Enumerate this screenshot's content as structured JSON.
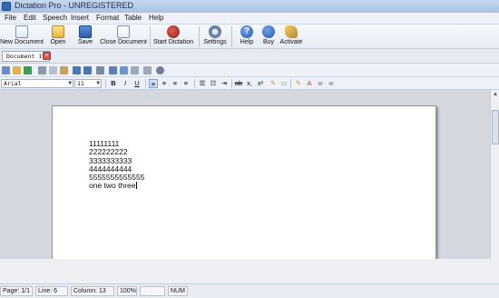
{
  "window": {
    "title": "Dictation Pro - UNREGISTERED"
  },
  "menu": [
    "File",
    "Edit",
    "Speech",
    "Insert",
    "Format",
    "Table",
    "Help"
  ],
  "toolbar": {
    "new_document": "New Document",
    "open": "Open",
    "save": "Save",
    "close_document": "Close Document",
    "start_dictation": "Start Dictation",
    "settings": "Settings",
    "help": "Help",
    "buy": "Buy",
    "activate": "Activate"
  },
  "tab": {
    "label": "Document 1*"
  },
  "format": {
    "font": "Arial",
    "size": "11"
  },
  "document": {
    "lines": [
      "11111111",
      "222222222",
      "3333333333",
      "4444444444",
      "5555555555555",
      "one two three"
    ]
  },
  "status": {
    "page": "Page: 1/1",
    "line": "Line: 6",
    "column": "Column: 13",
    "zoom": "100%",
    "num": "NUM"
  },
  "colors": {
    "accent": "#2e6ab3",
    "title_bar": "#b8cde8"
  }
}
